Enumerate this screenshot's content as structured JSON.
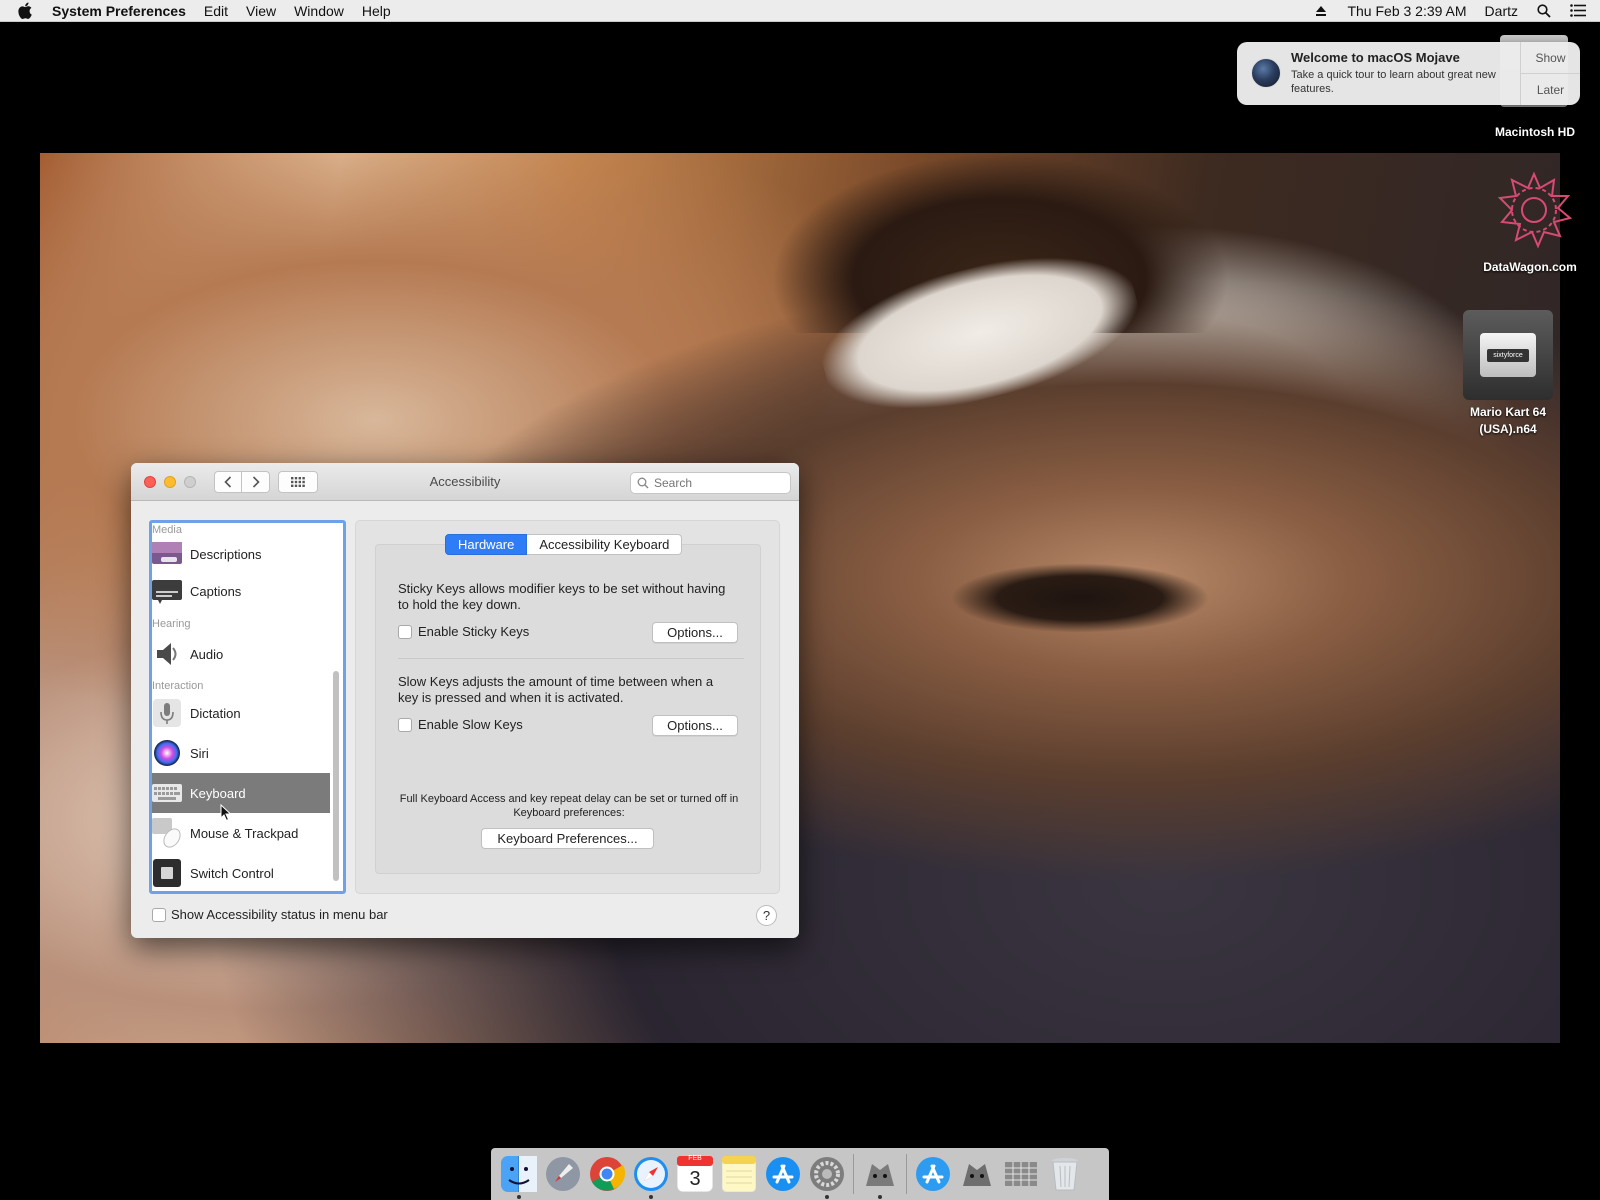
{
  "menubar": {
    "app_name": "System Preferences",
    "items": [
      "Edit",
      "View",
      "Window",
      "Help"
    ],
    "clock": "Thu Feb 3  2:39 AM",
    "user": "Dartz"
  },
  "notification": {
    "title": "Welcome to macOS Mojave",
    "text": "Take a quick tour to learn about great new features.",
    "show_label": "Show",
    "later_label": "Later"
  },
  "desktop": {
    "drive_label": "Macintosh HD",
    "datawagon_label": "DataWagon.com",
    "n64_label_line1": "Mario Kart 64",
    "n64_label_line2": "(USA).n64",
    "n64_cart_text": "sixtyforce"
  },
  "window": {
    "title": "Accessibility",
    "search_placeholder": "Search",
    "sidebar": {
      "sections": {
        "media": "Media",
        "hearing": "Hearing",
        "interaction": "Interaction"
      },
      "items": {
        "descriptions": "Descriptions",
        "captions": "Captions",
        "audio": "Audio",
        "dictation": "Dictation",
        "siri": "Siri",
        "keyboard": "Keyboard",
        "mouse": "Mouse & Trackpad",
        "switch": "Switch Control"
      },
      "selected": "Keyboard"
    },
    "tabs": {
      "hardware": "Hardware",
      "accessibility_keyboard": "Accessibility Keyboard",
      "active": "Hardware"
    },
    "sticky": {
      "description": "Sticky Keys allows modifier keys to be set without having to hold the key down.",
      "checkbox_label": "Enable Sticky Keys",
      "checked": false,
      "options_label": "Options..."
    },
    "slow": {
      "description": "Slow Keys adjusts the amount of time between when a key is pressed and when it is activated.",
      "checkbox_label": "Enable Slow Keys",
      "checked": false,
      "options_label": "Options..."
    },
    "footnote": "Full Keyboard Access and key repeat delay can be set or turned off in Keyboard preferences:",
    "keyboard_prefs_label": "Keyboard Preferences...",
    "status_checkbox_label": "Show Accessibility status in menu bar",
    "status_checked": false,
    "help_label": "?"
  },
  "dock": {
    "calendar_day": "3",
    "calendar_month": "FEB",
    "items": [
      "finder-icon",
      "launchpad-icon",
      "chrome-icon",
      "safari-icon",
      "calendar-icon",
      "notes-icon",
      "app-store-icon",
      "system-preferences-icon",
      "sixtyforce-icon",
      "app-store-downloads-icon",
      "sixtyforce-alt-icon",
      "desktop-stack-icon",
      "trash-icon"
    ]
  },
  "colors": {
    "accent": "#2f7df6",
    "selection": "#7b7b7b",
    "close": "#fe5f57",
    "minimize": "#febc2e"
  }
}
